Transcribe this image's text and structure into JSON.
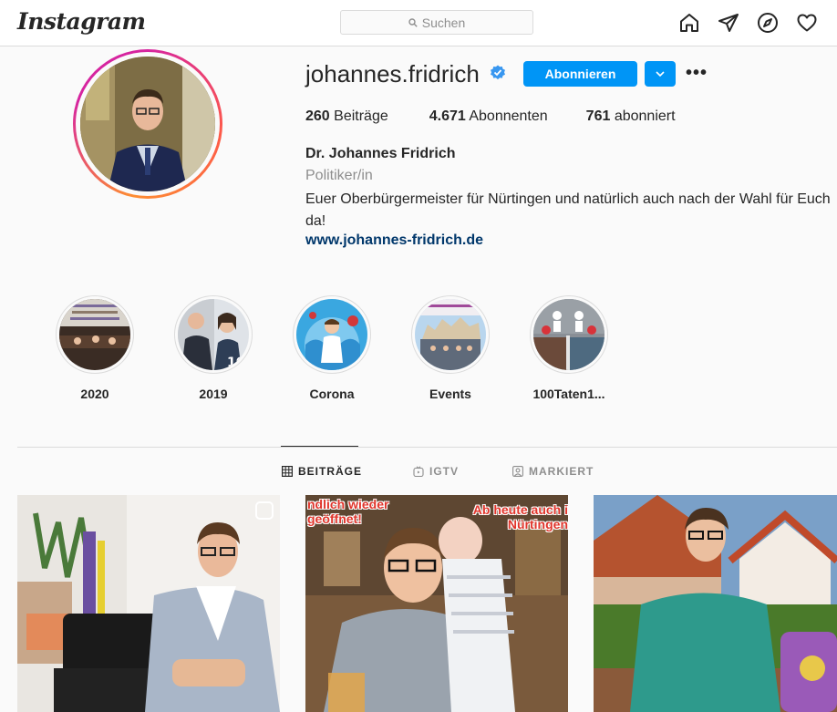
{
  "header": {
    "logo": "Instagram",
    "search_placeholder": "Suchen"
  },
  "profile": {
    "username": "johannes.fridrich",
    "follow_label": "Abonnieren",
    "more_label": "•••",
    "stats": {
      "posts_count": "260",
      "posts_label": "Beiträge",
      "followers_count": "4.671",
      "followers_label": "Abonnenten",
      "following_count": "761",
      "following_label": "abonniert"
    },
    "full_name": "Dr. Johannes Fridrich",
    "category": "Politiker/in",
    "bio": "Euer Oberbürgermeister für Nürtingen und natürlich auch nach der Wahl für Euch da!",
    "website": "www.johannes-fridrich.de"
  },
  "highlights": [
    {
      "label": "2020"
    },
    {
      "label": "2019"
    },
    {
      "label": "Corona"
    },
    {
      "label": "Events"
    },
    {
      "label": "100Taten1..."
    }
  ],
  "tabs": [
    {
      "label": "BEITRÄGE",
      "active": true
    },
    {
      "label": "IGTV",
      "active": false
    },
    {
      "label": "MARKIERT",
      "active": false
    }
  ],
  "posts": [
    {
      "overlay_left": "",
      "overlay_right": ""
    },
    {
      "overlay_left": "ndlich wieder geöffnet!",
      "overlay_right": "Ab heute auch i Nürtingen"
    },
    {
      "overlay_left": "",
      "overlay_right": ""
    }
  ],
  "colors": {
    "accent": "#0095f6",
    "link": "#00376b",
    "verified": "#3897f0"
  }
}
